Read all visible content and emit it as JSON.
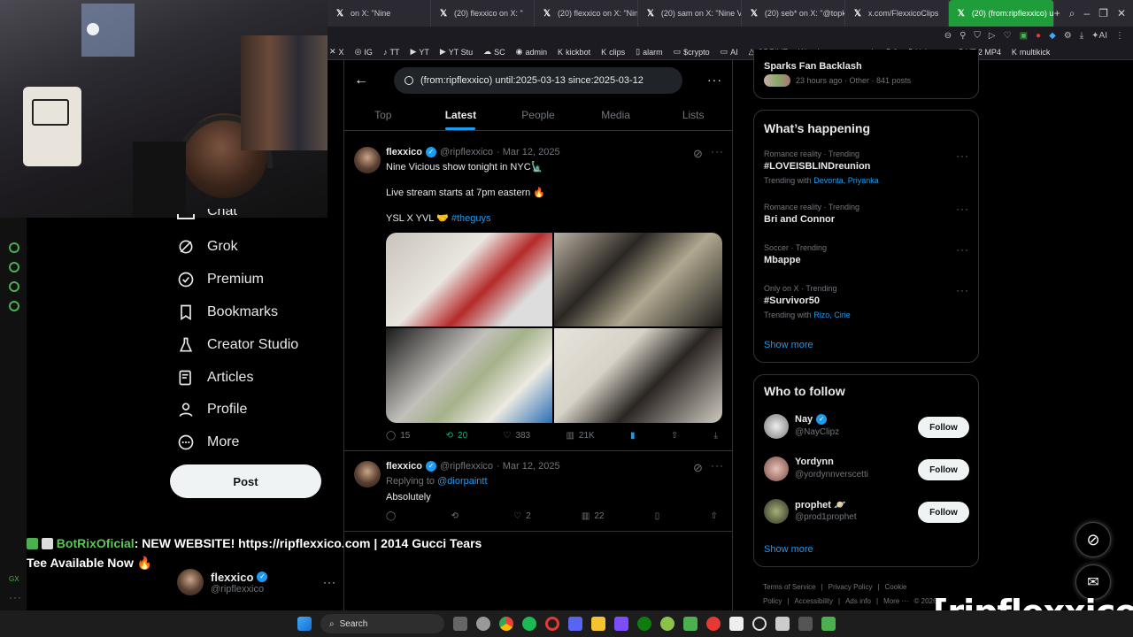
{
  "browser": {
    "tabs": [
      {
        "label": "on X: \"Nine",
        "active": false
      },
      {
        "label": "(20) flexxico on X: \"",
        "active": false
      },
      {
        "label": "(20) flexxico on X: \"Nine",
        "active": false
      },
      {
        "label": "(20) sam on X: \"Nine Vic",
        "active": false
      },
      {
        "label": "(20) seb* on X: \"@topki",
        "active": false
      },
      {
        "label": "x.com/FlexxicoClips",
        "active": false
      },
      {
        "label": "(20) (from:ripflexxico) unt",
        "active": true
      }
    ],
    "bookmarks": [
      {
        "icon": "x-icon",
        "label": "X"
      },
      {
        "icon": "instagram-icon",
        "label": "IG"
      },
      {
        "icon": "tiktok-icon",
        "label": "TT"
      },
      {
        "icon": "youtube-icon",
        "label": "YT"
      },
      {
        "icon": "youtube-icon",
        "label": "YT Stu"
      },
      {
        "icon": "soundcloud-icon",
        "label": "SC"
      },
      {
        "icon": "admin-icon",
        "label": "admin"
      },
      {
        "icon": "kick-icon",
        "label": "kickbot"
      },
      {
        "icon": "kick-icon",
        "label": "clips"
      },
      {
        "icon": "file-icon",
        "label": "alarm"
      },
      {
        "icon": "folder-icon",
        "label": "$crypto"
      },
      {
        "icon": "folder-icon",
        "label": "AI"
      },
      {
        "icon": "drive-icon",
        "label": "GDRIVE"
      },
      {
        "icon": "anime-icon",
        "label": "aniwave"
      },
      {
        "icon": "folder-icon",
        "label": "work"
      },
      {
        "icon": "file-icon",
        "label": "3"
      },
      {
        "icon": "file-icon",
        "label": "kick stats"
      },
      {
        "icon": "file-icon",
        "label": "YT 2 MP4"
      },
      {
        "icon": "kick-icon",
        "label": "multikick"
      }
    ]
  },
  "sidebar": {
    "partial_item": "Chat",
    "items": [
      {
        "icon": "grok-icon",
        "label": "Grok"
      },
      {
        "icon": "premium-icon",
        "label": "Premium"
      },
      {
        "icon": "bookmark-icon",
        "label": "Bookmarks"
      },
      {
        "icon": "creator-studio-icon",
        "label": "Creator Studio"
      },
      {
        "icon": "articles-icon",
        "label": "Articles"
      },
      {
        "icon": "profile-icon",
        "label": "Profile"
      },
      {
        "icon": "more-icon",
        "label": "More"
      }
    ],
    "post_button": "Post",
    "account": {
      "name": "flexxico",
      "handle": "@ripflexxico"
    }
  },
  "chat_overlay": {
    "user": "BotRixOficial",
    "message": ": NEW WEBSITE! https://ripflexxico.com | 2014 Gucci Tears Tee Available Now 🔥"
  },
  "search": {
    "query": "(from:ripflexxico) until:2025-03-13 since:2025-03-12",
    "tabs": [
      "Top",
      "Latest",
      "People",
      "Media",
      "Lists"
    ],
    "active_tab": "Latest"
  },
  "tweets": [
    {
      "name": "flexxico",
      "handle": "@ripflexxico",
      "date": "· Mar 12, 2025",
      "lines": [
        "Nine Vicious show tonight in NYC🗽",
        "Live stream starts at 7pm eastern 🔥",
        "YSL X YVL 🤝"
      ],
      "hashtag": "#theguys",
      "replies": "15",
      "reposts": "20",
      "likes": "383",
      "views": "21K"
    },
    {
      "name": "flexxico",
      "handle": "@ripflexxico",
      "date": "· Mar 12, 2025",
      "replying_label": "Replying to",
      "replying_to": "@diorpaintt",
      "text": "Absolutely",
      "replies": "",
      "reposts": "",
      "likes": "2",
      "views": "22"
    }
  ],
  "right": {
    "top_partial": {
      "title": "Sparks Fan Backlash",
      "meta": "23 hours ago · Other · 841 posts"
    },
    "happening_title": "What’s happening",
    "trends": [
      {
        "meta": "Romance reality · Trending",
        "name": "#LOVEISBLINDreunion",
        "with_label": "Trending with",
        "with": "Devonta, Priyanka"
      },
      {
        "meta": "Romance reality · Trending",
        "name": "Bri and Connor",
        "with_label": "",
        "with": ""
      },
      {
        "meta": "Soccer · Trending",
        "name": "Mbappe",
        "with_label": "",
        "with": ""
      },
      {
        "meta": "Only on X · Trending",
        "name": "#Survivor50",
        "with_label": "Trending with",
        "with": "Rizo, Cirie"
      }
    ],
    "show_more": "Show more",
    "who_title": "Who to follow",
    "follow": [
      {
        "name": "Nay",
        "handle": "@NayClipz",
        "badge": "verified",
        "button": "Follow"
      },
      {
        "name": "Yordynn",
        "handle": "@yordynnverscetti",
        "badge": "",
        "button": "Follow"
      },
      {
        "name": "prophet 🪐",
        "handle": "@prod1prophet",
        "badge": "",
        "button": "Follow"
      }
    ],
    "footer": [
      "Terms of Service",
      "|",
      "Privacy Policy",
      "|",
      "Cookie Policy",
      "|",
      "Accessibility",
      "|",
      "Ads info",
      "|",
      "More ···",
      "© 2026 X Co"
    ]
  },
  "taskbar": {
    "search_label": "Search"
  },
  "watermark": "[ripflexxico]",
  "colors": {
    "accent": "#1d9bf0",
    "repost": "#00ba7c",
    "chat_user": "#5fc45a",
    "active_tab": "#1f9d3a"
  }
}
